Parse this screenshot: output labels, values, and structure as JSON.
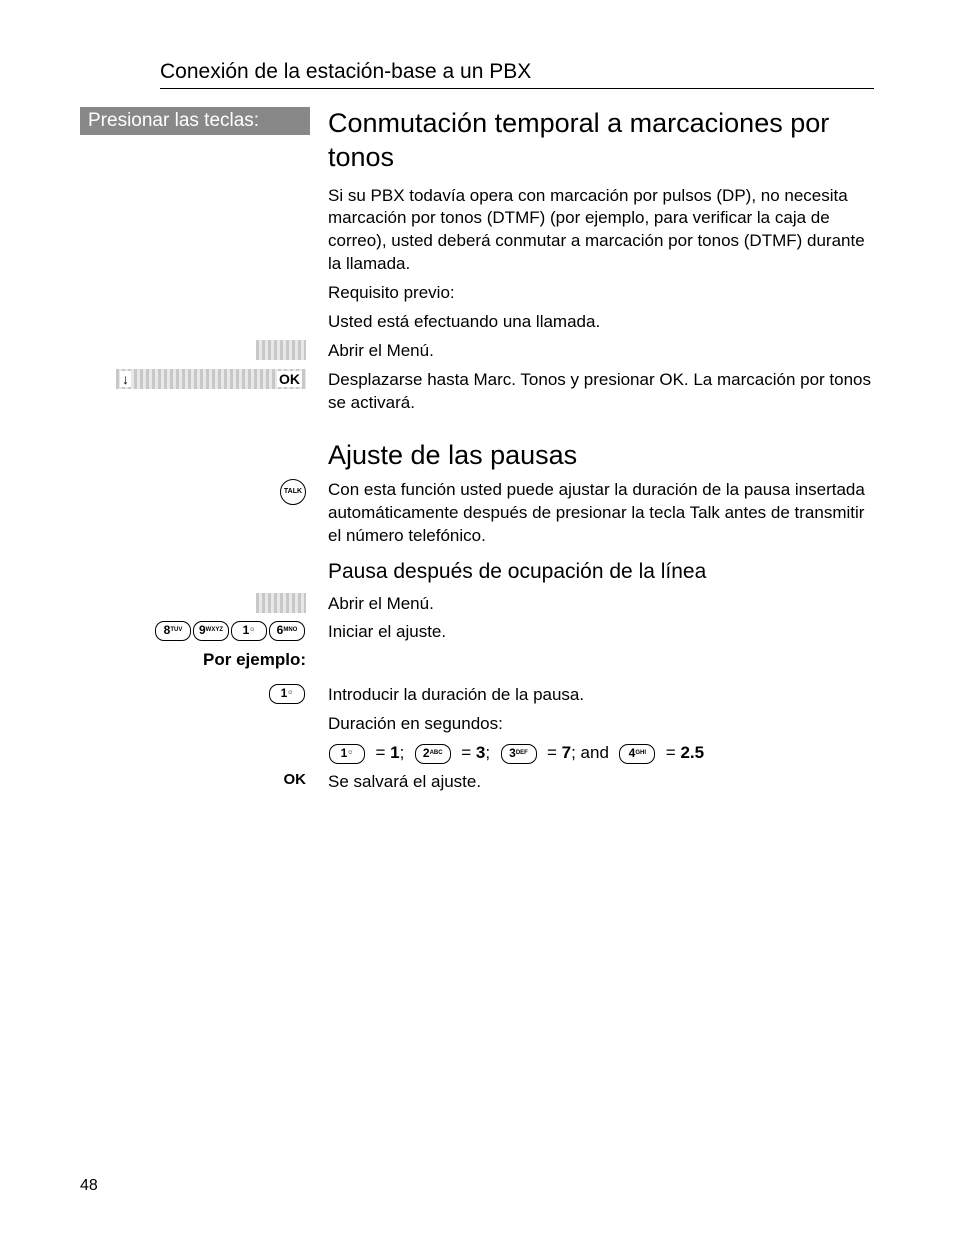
{
  "header": "Conexión de la estación-base a un PBX",
  "leftHeader": "Presionar las teclas:",
  "sec1": {
    "title": "Conmutación temporal a marcaciones por tonos",
    "p1": "Si su PBX todavía opera con marcación por pulsos (DP), no necesita marcación por tonos (DTMF) (por ejemplo, para verificar la caja de correo), usted deberá conmutar a marcación por tonos (DTMF) durante la llamada.",
    "p2": "Requisito previo:",
    "p3": "Usted está efectuando una llamada.",
    "menuOpen": "Abrir el Menú.",
    "scroll": "Desplazarse hasta Marc. Tonos y presionar OK. La marcación por tonos se activará."
  },
  "softkey": {
    "down": "↓",
    "ok": "OK"
  },
  "sec2": {
    "title": "Ajuste de las pausas",
    "talkDesc": "Con esta función usted puede ajustar la duración de la pausa insertada automáticamente después de presionar la tecla Talk antes de transmitir el número telefónico.",
    "sub": "Pausa después de ocupación de la línea",
    "menuOpen": "Abrir el Menú.",
    "init": "Iniciar el ajuste.",
    "porEj": "Por ejemplo:",
    "enterDur": "Introducir la duración de la pausa.",
    "durLabel": "Duración en segundos:",
    "save": "Se salvará el ajuste."
  },
  "keys": {
    "seq": [
      {
        "d": "8",
        "l": "TUV"
      },
      {
        "d": "9",
        "l": "WXYZ"
      },
      {
        "d": "1",
        "l": "☺"
      },
      {
        "d": "6",
        "l": "MNO"
      }
    ],
    "k1": {
      "d": "1",
      "l": "☺"
    },
    "talk": "TALK",
    "ok": "OK"
  },
  "durations": {
    "k1": {
      "d": "1",
      "l": "☺",
      "v": "1"
    },
    "k2": {
      "d": "2",
      "l": "ABC",
      "v": "3"
    },
    "k3": {
      "d": "3",
      "l": "DEF",
      "v": "7"
    },
    "k4": {
      "d": "4",
      "l": "GHI",
      "v": "2.5"
    },
    "and": "and"
  },
  "pageNum": "48"
}
